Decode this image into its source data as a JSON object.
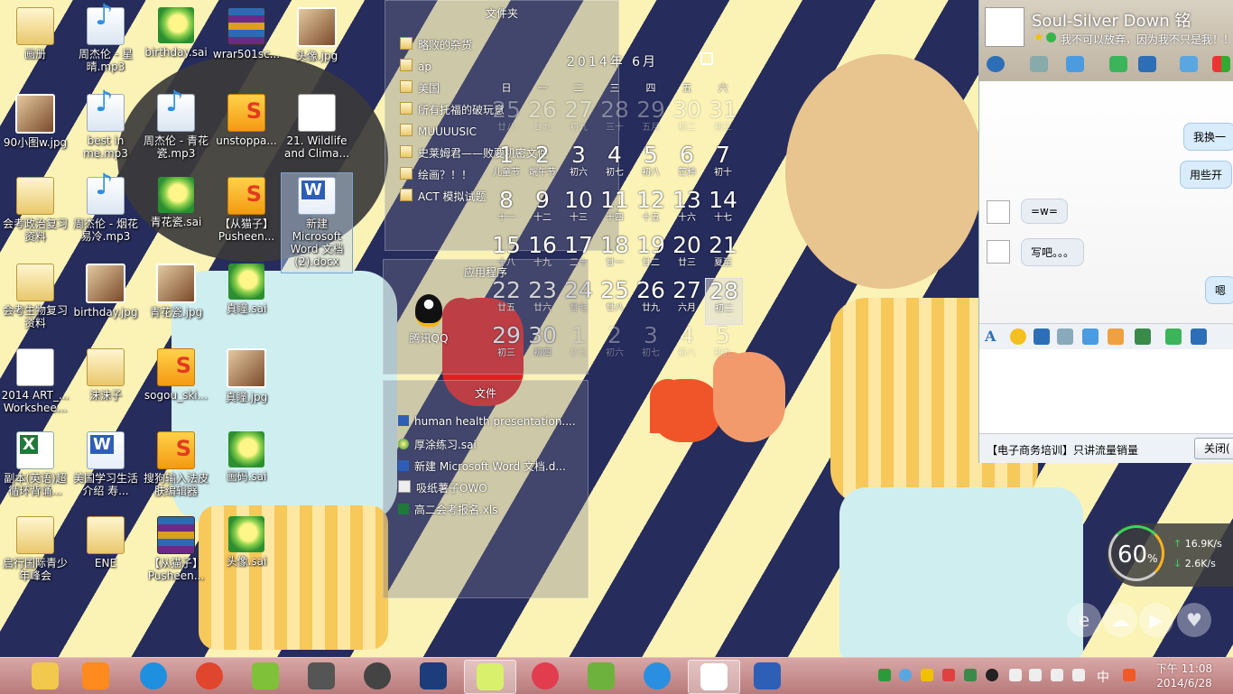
{
  "desktop": {
    "icons": [
      {
        "label": "画册"
      },
      {
        "label": "周杰伦 - 星晴.mp3"
      },
      {
        "label": "birthday.sai"
      },
      {
        "label": "wrar501sc..."
      },
      {
        "label": "头像.jpg"
      },
      {
        "label": "90小图w.jpg"
      },
      {
        "label": "best in me.mp3"
      },
      {
        "label": "周杰伦 - 青花瓷.mp3"
      },
      {
        "label": "unstoppa..."
      },
      {
        "label": "21. Wildlife and Clima..."
      },
      {
        "label": "会考政治复习资料"
      },
      {
        "label": "周杰伦 - 烟花易冷.mp3"
      },
      {
        "label": "青花瓷.sai"
      },
      {
        "label": "【从猫子】Pusheen..."
      },
      {
        "label": "新建 Microsoft Word 文档 (2).docx"
      },
      {
        "label": "会考生物复习资料"
      },
      {
        "label": "birthday.jpg"
      },
      {
        "label": "青花瓷.jpg"
      },
      {
        "label": "真瞳.sai"
      },
      {
        "label": "2014 ART_... Workshee..."
      },
      {
        "label": "沫沫子"
      },
      {
        "label": "sogou_ski..."
      },
      {
        "label": "真瞳.jpg"
      },
      {
        "label": "副本(英语)超循环背诵..."
      },
      {
        "label": "美国学习生活介绍 寿..."
      },
      {
        "label": "搜狗输入法皮肤编辑器"
      },
      {
        "label": "画码.sai"
      },
      {
        "label": "启行国际青少年峰会"
      },
      {
        "label": "ENE"
      },
      {
        "label": "【从猫子】Pusheen..."
      },
      {
        "label": "头像.sai"
      }
    ]
  },
  "folders_panel": {
    "title": "文件夹",
    "items": [
      "略败的杂货",
      "ap",
      "美国",
      "所有托福的破玩意",
      "MUUUUSIC",
      "史莱姆君——败要机密文件",
      "绘画？！！",
      "ACT 模拟试题"
    ]
  },
  "apps_panel": {
    "title": "应用程序",
    "items": [
      "腾讯QQ"
    ]
  },
  "files_panel": {
    "title": "文件",
    "items": [
      "human health presentation....",
      "厚涂练习.sai",
      "新建 Microsoft Word 文档.d...",
      "吸纸薯子OWO",
      "高二会考报名.xls"
    ]
  },
  "calendar": {
    "header": "2014年 6月",
    "weekdays": [
      "日",
      "一",
      "二",
      "三",
      "四",
      "五",
      "六"
    ],
    "cells": [
      {
        "n": "25",
        "l": "廿八",
        "dim": true
      },
      {
        "n": "26",
        "l": "廿九",
        "dim": true
      },
      {
        "n": "27",
        "l": "初九",
        "dim": true
      },
      {
        "n": "28",
        "l": "三十",
        "dim": true
      },
      {
        "n": "29",
        "l": "五月",
        "dim": true
      },
      {
        "n": "30",
        "l": "初二",
        "dim": true
      },
      {
        "n": "31",
        "l": "初三",
        "dim": true
      },
      {
        "n": "1",
        "l": "儿童节",
        "dim": false
      },
      {
        "n": "2",
        "l": "端午节",
        "dim": false
      },
      {
        "n": "3",
        "l": "初六",
        "dim": false
      },
      {
        "n": "4",
        "l": "初七",
        "dim": false
      },
      {
        "n": "5",
        "l": "初八",
        "dim": false
      },
      {
        "n": "6",
        "l": "芒种",
        "dim": false
      },
      {
        "n": "7",
        "l": "初十",
        "dim": false
      },
      {
        "n": "8",
        "l": "十一",
        "dim": false
      },
      {
        "n": "9",
        "l": "十二",
        "dim": false
      },
      {
        "n": "10",
        "l": "十三",
        "dim": false
      },
      {
        "n": "11",
        "l": "十四",
        "dim": false
      },
      {
        "n": "12",
        "l": "十五",
        "dim": false
      },
      {
        "n": "13",
        "l": "十六",
        "dim": false
      },
      {
        "n": "14",
        "l": "十七",
        "dim": false
      },
      {
        "n": "15",
        "l": "十八",
        "dim": false
      },
      {
        "n": "16",
        "l": "十九",
        "dim": false
      },
      {
        "n": "17",
        "l": "二十",
        "dim": false
      },
      {
        "n": "18",
        "l": "廿一",
        "dim": false
      },
      {
        "n": "19",
        "l": "廿二",
        "dim": false
      },
      {
        "n": "20",
        "l": "廿三",
        "dim": false
      },
      {
        "n": "21",
        "l": "夏至",
        "dim": false
      },
      {
        "n": "22",
        "l": "廿五",
        "dim": false
      },
      {
        "n": "23",
        "l": "廿六",
        "dim": false
      },
      {
        "n": "24",
        "l": "廿七",
        "dim": false
      },
      {
        "n": "25",
        "l": "廿八",
        "dim": false
      },
      {
        "n": "26",
        "l": "廿九",
        "dim": false
      },
      {
        "n": "27",
        "l": "六月",
        "dim": false
      },
      {
        "n": "28",
        "l": "初二",
        "dim": false,
        "today": true
      },
      {
        "n": "29",
        "l": "初三",
        "dim": false
      },
      {
        "n": "30",
        "l": "初四",
        "dim": false
      },
      {
        "n": "1",
        "l": "初五",
        "dim": true
      },
      {
        "n": "2",
        "l": "初六",
        "dim": true
      },
      {
        "n": "3",
        "l": "初七",
        "dim": true
      },
      {
        "n": "4",
        "l": "初八",
        "dim": true
      },
      {
        "n": "5",
        "l": "初九",
        "dim": true
      }
    ]
  },
  "qq": {
    "name": "Soul-Silver Down 铭",
    "signature": "我不可以放弃，因为我不只是我！！",
    "messages": [
      {
        "text": "我换一",
        "from": "me"
      },
      {
        "text": "用些开",
        "from": "me"
      },
      {
        "text": "=w=",
        "from": "them"
      },
      {
        "text": "写吧。。。",
        "from": "them"
      },
      {
        "text": "嗯",
        "from": "me"
      }
    ],
    "ad": "【电子商务培训】只讲流量销量",
    "close_label": "关闭("
  },
  "meter": {
    "percent": "60",
    "percent_unit": "%",
    "up": "16.9",
    "down": "2.6",
    "unit": "K/s"
  },
  "taskbar": {
    "ime": "中",
    "time": "下午 11:08",
    "date": "2014/6/28",
    "apps": [
      "file-explorer",
      "media-player",
      "sogou-browser",
      "chrome",
      "sai",
      "microphone",
      "video",
      "photoshop",
      "sticky-notes",
      "meitu",
      "sai-2",
      "qq-browser",
      "qq-chat",
      "word"
    ],
    "app_colors": [
      "#f2c94c",
      "#ff8a1e",
      "#1f8fe0",
      "#e0452d",
      "#7fc23a",
      "#555555",
      "#444444",
      "#1c3d7a",
      "#d8f06b",
      "#e23c4f",
      "#6db23c",
      "#2a8fe0",
      "#ffffff",
      "#2e5fb7"
    ]
  }
}
